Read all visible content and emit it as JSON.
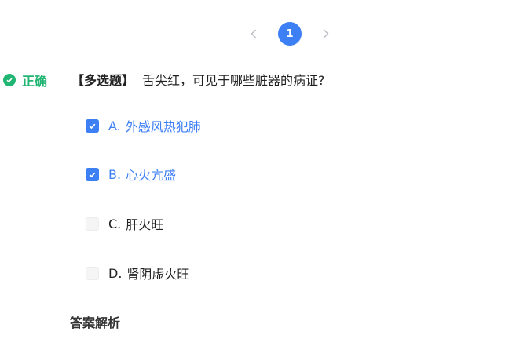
{
  "pagination": {
    "current_page": "1",
    "prev_icon": "chevron-left-icon",
    "next_icon": "chevron-right-icon"
  },
  "result": {
    "label": "正确",
    "icon": "check-circle-icon",
    "color": "#21b573"
  },
  "question": {
    "type": "【多选题】",
    "text": "舌尖红，可见于哪些脏器的病证?"
  },
  "options": [
    {
      "key": "A.",
      "text": "外感风热犯肺",
      "checked": true
    },
    {
      "key": "B.",
      "text": "心火亢盛",
      "checked": true
    },
    {
      "key": "C.",
      "text": "肝火旺",
      "checked": false
    },
    {
      "key": "D.",
      "text": "肾阴虚火旺",
      "checked": false
    }
  ],
  "analysis": {
    "label": "答案解析"
  },
  "colors": {
    "accent": "#3d7ff5",
    "success": "#21b573"
  }
}
